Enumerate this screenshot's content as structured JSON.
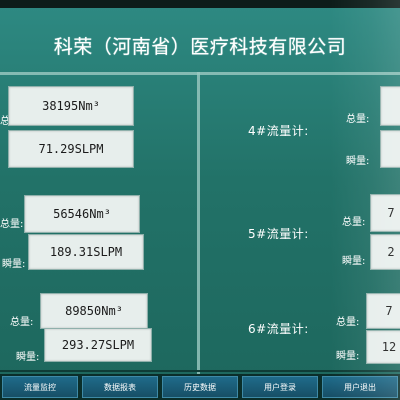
{
  "header": {
    "title": "科荣（河南省）医疗科技有限公司"
  },
  "labels": {
    "total": "总量:",
    "instant": "瞬量:"
  },
  "left_meters": [
    {
      "total": "38195Nm³",
      "instant": "71.29SLPM"
    },
    {
      "total": "56546Nm³",
      "instant": "189.31SLPM"
    },
    {
      "total": "89850Nm³",
      "instant": "293.27SLPM"
    }
  ],
  "right_meters": [
    {
      "title": "4#流量计:",
      "total": "",
      "instant": ""
    },
    {
      "title": "5#流量计:",
      "total": "7",
      "instant": "2"
    },
    {
      "title": "6#流量计:",
      "total": "7",
      "instant": "12"
    }
  ],
  "nav": [
    "流量监控",
    "数据报表",
    "历史数据",
    "用户登录",
    "用户退出"
  ]
}
